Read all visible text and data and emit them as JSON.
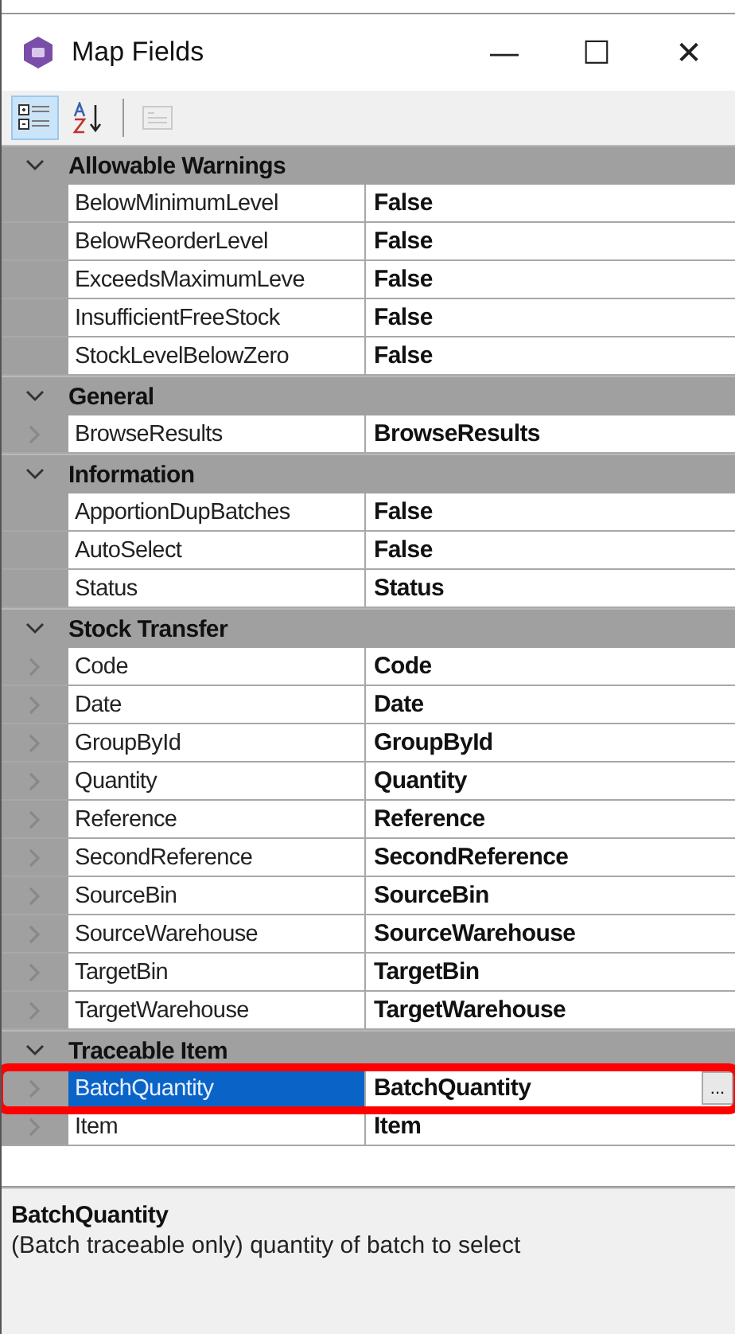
{
  "window": {
    "title": "Map Fields",
    "controls": [
      "—",
      "☐",
      "✕"
    ]
  },
  "toolbar": [
    {
      "kind": "categorized",
      "selected": true
    },
    {
      "kind": "alphabetical",
      "selected": false
    },
    {
      "kind": "pages",
      "selected": false,
      "disabled": true
    }
  ],
  "categories": [
    {
      "title": "Allowable Warnings",
      "expanded": true,
      "rows": [
        {
          "name": "BelowMinimumLevel",
          "value": "False",
          "expandable": false,
          "selected": false,
          "highlighted": false
        },
        {
          "name": "BelowReorderLevel",
          "value": "False",
          "expandable": false,
          "selected": false,
          "highlighted": false
        },
        {
          "name": "ExceedsMaximumLeve",
          "value": "False",
          "expandable": false,
          "selected": false,
          "highlighted": false
        },
        {
          "name": "InsufficientFreeStock",
          "value": "False",
          "expandable": false,
          "selected": false,
          "highlighted": false
        },
        {
          "name": "StockLevelBelowZero",
          "value": "False",
          "expandable": false,
          "selected": false,
          "highlighted": false
        }
      ]
    },
    {
      "title": "General",
      "expanded": true,
      "rows": [
        {
          "name": "BrowseResults",
          "value": "BrowseResults",
          "expandable": true,
          "selected": false,
          "highlighted": false
        }
      ]
    },
    {
      "title": "Information",
      "expanded": true,
      "rows": [
        {
          "name": "ApportionDupBatches",
          "value": "False",
          "expandable": false,
          "selected": false,
          "highlighted": false
        },
        {
          "name": "AutoSelect",
          "value": "False",
          "expandable": false,
          "selected": false,
          "highlighted": false
        },
        {
          "name": "Status",
          "value": "Status",
          "expandable": false,
          "selected": false,
          "highlighted": false
        }
      ]
    },
    {
      "title": "Stock Transfer",
      "expanded": true,
      "rows": [
        {
          "name": "Code",
          "value": "Code",
          "expandable": true,
          "selected": false,
          "highlighted": false
        },
        {
          "name": "Date",
          "value": "Date",
          "expandable": true,
          "selected": false,
          "highlighted": false
        },
        {
          "name": "GroupById",
          "value": "GroupById",
          "expandable": true,
          "selected": false,
          "highlighted": false
        },
        {
          "name": "Quantity",
          "value": "Quantity",
          "expandable": true,
          "selected": false,
          "highlighted": false
        },
        {
          "name": "Reference",
          "value": "Reference",
          "expandable": true,
          "selected": false,
          "highlighted": false
        },
        {
          "name": "SecondReference",
          "value": "SecondReference",
          "expandable": true,
          "selected": false,
          "highlighted": false
        },
        {
          "name": "SourceBin",
          "value": "SourceBin",
          "expandable": true,
          "selected": false,
          "highlighted": false
        },
        {
          "name": "SourceWarehouse",
          "value": "SourceWarehouse",
          "expandable": true,
          "selected": false,
          "highlighted": false
        },
        {
          "name": "TargetBin",
          "value": "TargetBin",
          "expandable": true,
          "selected": false,
          "highlighted": false
        },
        {
          "name": "TargetWarehouse",
          "value": "TargetWarehouse",
          "expandable": true,
          "selected": false,
          "highlighted": false
        }
      ]
    },
    {
      "title": "Traceable Item",
      "expanded": true,
      "rows": [
        {
          "name": "BatchQuantity",
          "value": "BatchQuantity",
          "expandable": true,
          "selected": true,
          "highlighted": true,
          "button": "..."
        },
        {
          "name": "Item",
          "value": "Item",
          "expandable": true,
          "selected": false,
          "highlighted": false
        }
      ]
    }
  ],
  "help": {
    "title": "BatchQuantity",
    "description": "(Batch traceable only) quantity of batch to select"
  }
}
